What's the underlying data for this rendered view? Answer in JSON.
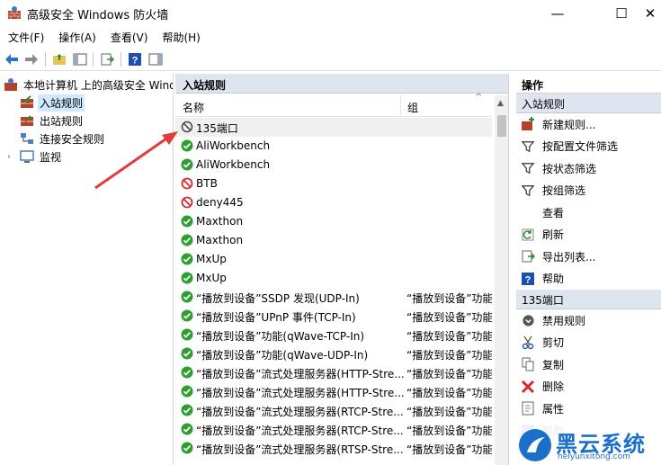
{
  "window": {
    "title": "高级安全 Windows 防火墙",
    "min": "—",
    "max": "☐",
    "close": "✕"
  },
  "menu": [
    "文件(F)",
    "操作(A)",
    "查看(V)",
    "帮助(H)"
  ],
  "tree": {
    "root": "本地计算机 上的高级安全 Windows 防火墙",
    "items": [
      "入站规则",
      "出站规则",
      "连接安全规则",
      "监视"
    ]
  },
  "center": {
    "title": "入站规则",
    "columns": [
      "名称",
      "组"
    ],
    "rows": [
      {
        "name": "135端口",
        "group": "",
        "status": "blocked-disabled"
      },
      {
        "name": "AliWorkbench",
        "group": "",
        "status": "allow"
      },
      {
        "name": "AliWorkbench",
        "group": "",
        "status": "allow"
      },
      {
        "name": "BTB",
        "group": "",
        "status": "block"
      },
      {
        "name": "deny445",
        "group": "",
        "status": "block"
      },
      {
        "name": "Maxthon",
        "group": "",
        "status": "allow"
      },
      {
        "name": "Maxthon",
        "group": "",
        "status": "allow"
      },
      {
        "name": "MxUp",
        "group": "",
        "status": "allow"
      },
      {
        "name": "MxUp",
        "group": "",
        "status": "allow"
      },
      {
        "name": "“播放到设备”SSDP 发现(UDP-In)",
        "group": "“播放到设备”功能",
        "status": "allow"
      },
      {
        "name": "“播放到设备”UPnP 事件(TCP-In)",
        "group": "“播放到设备”功能",
        "status": "allow"
      },
      {
        "name": "“播放到设备”功能(qWave-TCP-In)",
        "group": "“播放到设备”功能",
        "status": "allow"
      },
      {
        "name": "“播放到设备”功能(qWave-UDP-In)",
        "group": "“播放到设备”功能",
        "status": "allow"
      },
      {
        "name": "“播放到设备”流式处理服务器(HTTP-Stre...",
        "group": "“播放到设备”功能",
        "status": "allow"
      },
      {
        "name": "“播放到设备”流式处理服务器(HTTP-Stre...",
        "group": "“播放到设备”功能",
        "status": "allow"
      },
      {
        "name": "“播放到设备”流式处理服务器(RTCP-Stre...",
        "group": "“播放到设备”功能",
        "status": "allow"
      },
      {
        "name": "“播放到设备”流式处理服务器(RTCP-Stre...",
        "group": "“播放到设备”功能",
        "status": "allow"
      },
      {
        "name": "“播放到设备”流式处理服务器(RTSP-Stre...",
        "group": "“播放到设备”功能",
        "status": "allow"
      }
    ]
  },
  "actions": {
    "header": "操作",
    "section1": "入站规则",
    "items1": [
      "新建规则...",
      "按配置文件筛选",
      "按状态筛选",
      "按组筛选",
      "查看",
      "刷新",
      "导出列表...",
      "帮助"
    ],
    "section2": "135端口",
    "items2": [
      "禁用规则",
      "剪切",
      "复制",
      "删除",
      "属性",
      "帮助"
    ]
  },
  "watermark": {
    "brand": "黑云系统",
    "site": "heiyunxitong.com"
  },
  "colors": {
    "allow": "#2e9e2e",
    "block": "#d62a2a",
    "arrow": "#e03c3c",
    "header_bg": "#dfe5ee",
    "selection": "#cde8ff"
  }
}
